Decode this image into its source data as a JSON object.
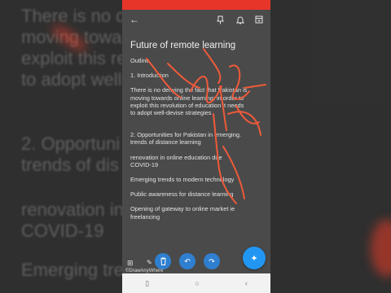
{
  "note": {
    "title": "Future of remote learning",
    "lines": [
      "Outline",
      "1. Introduction",
      "There is no denying the fact that Pakistan is",
      "moving towards online learning; in order to",
      "exploit this revolution of education it needs",
      "to adopt well-devise strategies",
      "2. Opportunities for  Pakistan in emerging.",
      "trends of distance learning",
      "renovation in online education due",
      "COVID-19",
      "Emerging trends to modern technology",
      "Public awareness for distance learning",
      "Opening of gateway to online market ie",
      "freelancing"
    ]
  },
  "background": {
    "lines": [
      "There is no d                          t Pakistan is",
      "moving towa                          in order to",
      "exploit this re                  lution of it needs",
      "to adopt well",
      "2. Opportuni                            emerging.",
      "trends of dis",
      "renovation in                    ue",
      "COVID-19",
      "Emerging tre                          nology"
    ]
  },
  "watermark": "©DrawAnyWhere",
  "icons": {
    "back": "arrow-left-icon",
    "pin": "pin-icon",
    "reminder": "bell-icon",
    "archive": "archive-icon",
    "pen": "pen-icon",
    "undo": "undo-icon",
    "redo": "redo-icon",
    "delete": "trash-icon"
  },
  "colors": {
    "status_bar": "#e8352a",
    "ink": "#ef5a3a",
    "fab": "#2196f3"
  }
}
